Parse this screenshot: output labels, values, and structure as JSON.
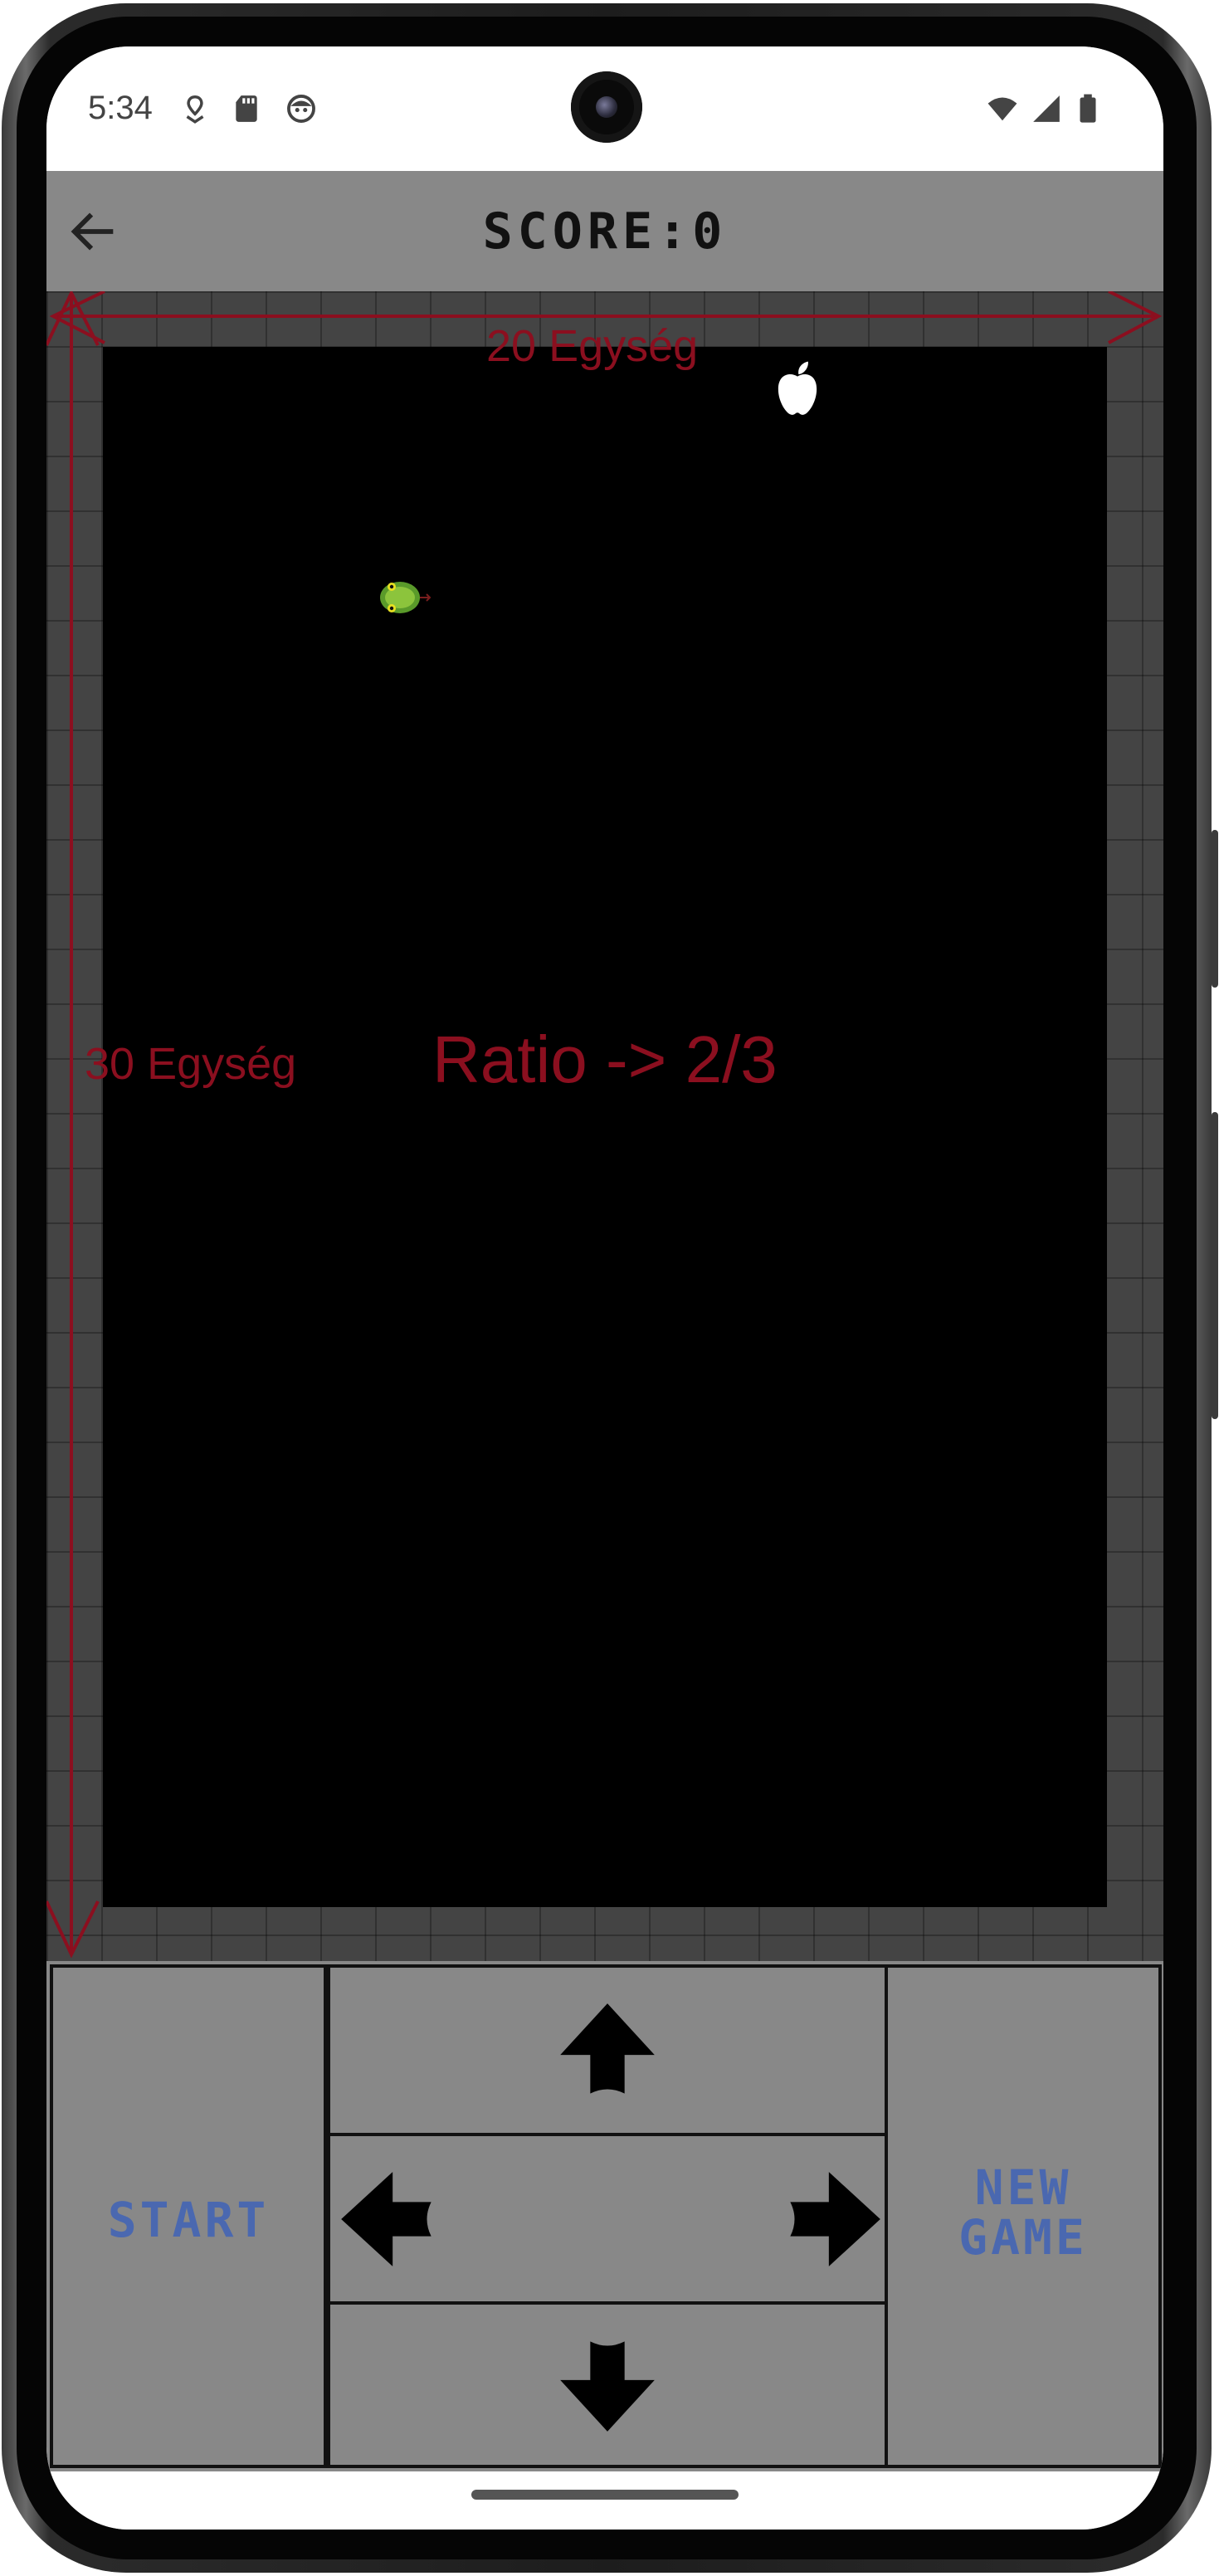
{
  "status_bar": {
    "time": "5:34",
    "left_icons": [
      "location-pin-icon",
      "sd-card-icon",
      "face-icon"
    ],
    "right_icons": [
      "wifi-icon",
      "cell-signal-icon",
      "battery-icon"
    ]
  },
  "app_bar": {
    "back_icon": "arrow-left-icon",
    "score_text": "SCORE:0"
  },
  "game": {
    "apple_icon": "apple-icon",
    "snake_icon": "snake-head-icon"
  },
  "annotations": {
    "width_label": "20 Egység",
    "height_label": "30 Egység",
    "ratio_label": "Ratio -> 2/3",
    "color": "#8b0f1f"
  },
  "controls": {
    "start_label": "START",
    "new_game_label_line1": "NEW",
    "new_game_label_line2": "GAME",
    "label_color": "#4a68b0",
    "arrows": [
      "arrow-up-icon",
      "arrow-left-icon",
      "arrow-right-icon",
      "arrow-down-icon"
    ]
  },
  "colors": {
    "app_bar_bg": "#888888",
    "board_bg": "#000000",
    "frame_bg": "#444444"
  }
}
